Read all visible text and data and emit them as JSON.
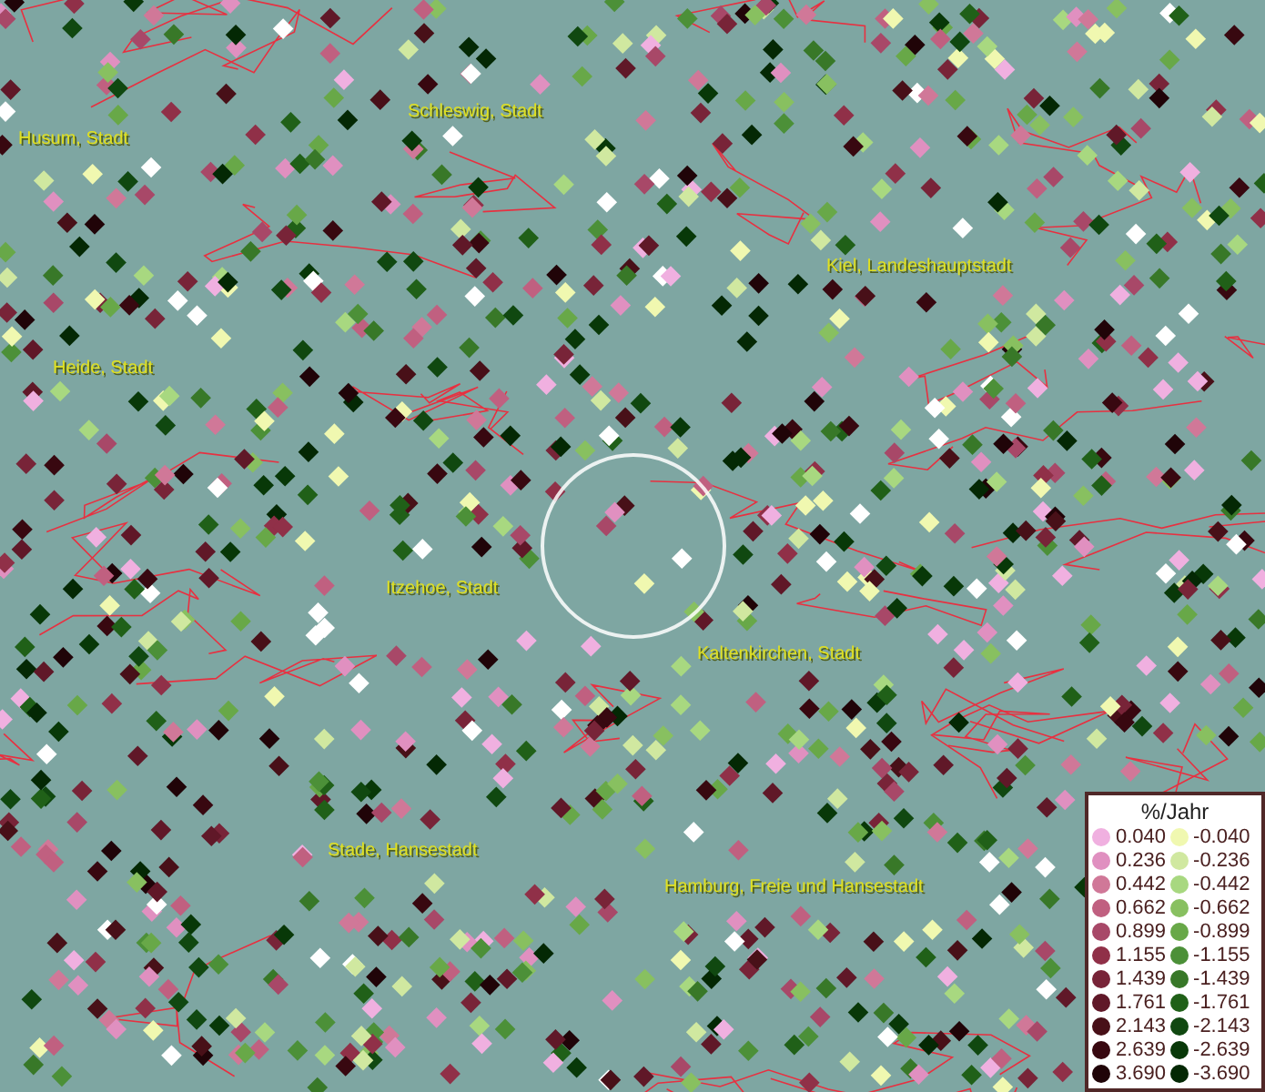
{
  "map": {
    "places": [
      {
        "name": "Husum, Stadt"
      },
      {
        "name": "Schleswig, Stadt"
      },
      {
        "name": "Kiel, Landeshauptstadt"
      },
      {
        "name": "Heide, Stadt"
      },
      {
        "name": "Itzehoe, Stadt"
      },
      {
        "name": "Kaltenkirchen, Stadt"
      },
      {
        "name": "Stade, Hansestadt"
      },
      {
        "name": "Hamburg, Freie und Hansestadt"
      }
    ]
  },
  "legend": {
    "title": "%/Jahr",
    "columns": [
      [
        {
          "label": "0.040",
          "color": "#f0b0e0"
        },
        {
          "label": "0.236",
          "color": "#e090c0"
        },
        {
          "label": "0.442",
          "color": "#d07898"
        },
        {
          "label": "0.662",
          "color": "#c06080"
        },
        {
          "label": "0.899",
          "color": "#a84868"
        },
        {
          "label": "1.155",
          "color": "#903048"
        },
        {
          "label": "1.439",
          "color": "#782438"
        },
        {
          "label": "1.761",
          "color": "#601828"
        },
        {
          "label": "2.143",
          "color": "#481018"
        },
        {
          "label": "2.639",
          "color": "#380810"
        },
        {
          "label": "3.690",
          "color": "#200408"
        }
      ],
      [
        {
          "label": "-0.040",
          "color": "#f0f8b0"
        },
        {
          "label": "-0.236",
          "color": "#d0e8a0"
        },
        {
          "label": "-0.442",
          "color": "#a8d880"
        },
        {
          "label": "-0.662",
          "color": "#88c060"
        },
        {
          "label": "-0.899",
          "color": "#68a848"
        },
        {
          "label": "-1.155",
          "color": "#4c9038"
        },
        {
          "label": "-1.439",
          "color": "#387828"
        },
        {
          "label": "-1.761",
          "color": "#206018"
        },
        {
          "label": "-2.143",
          "color": "#104810"
        },
        {
          "label": "-2.639",
          "color": "#083808"
        },
        {
          "label": "-3.690",
          "color": "#042804"
        }
      ]
    ]
  }
}
